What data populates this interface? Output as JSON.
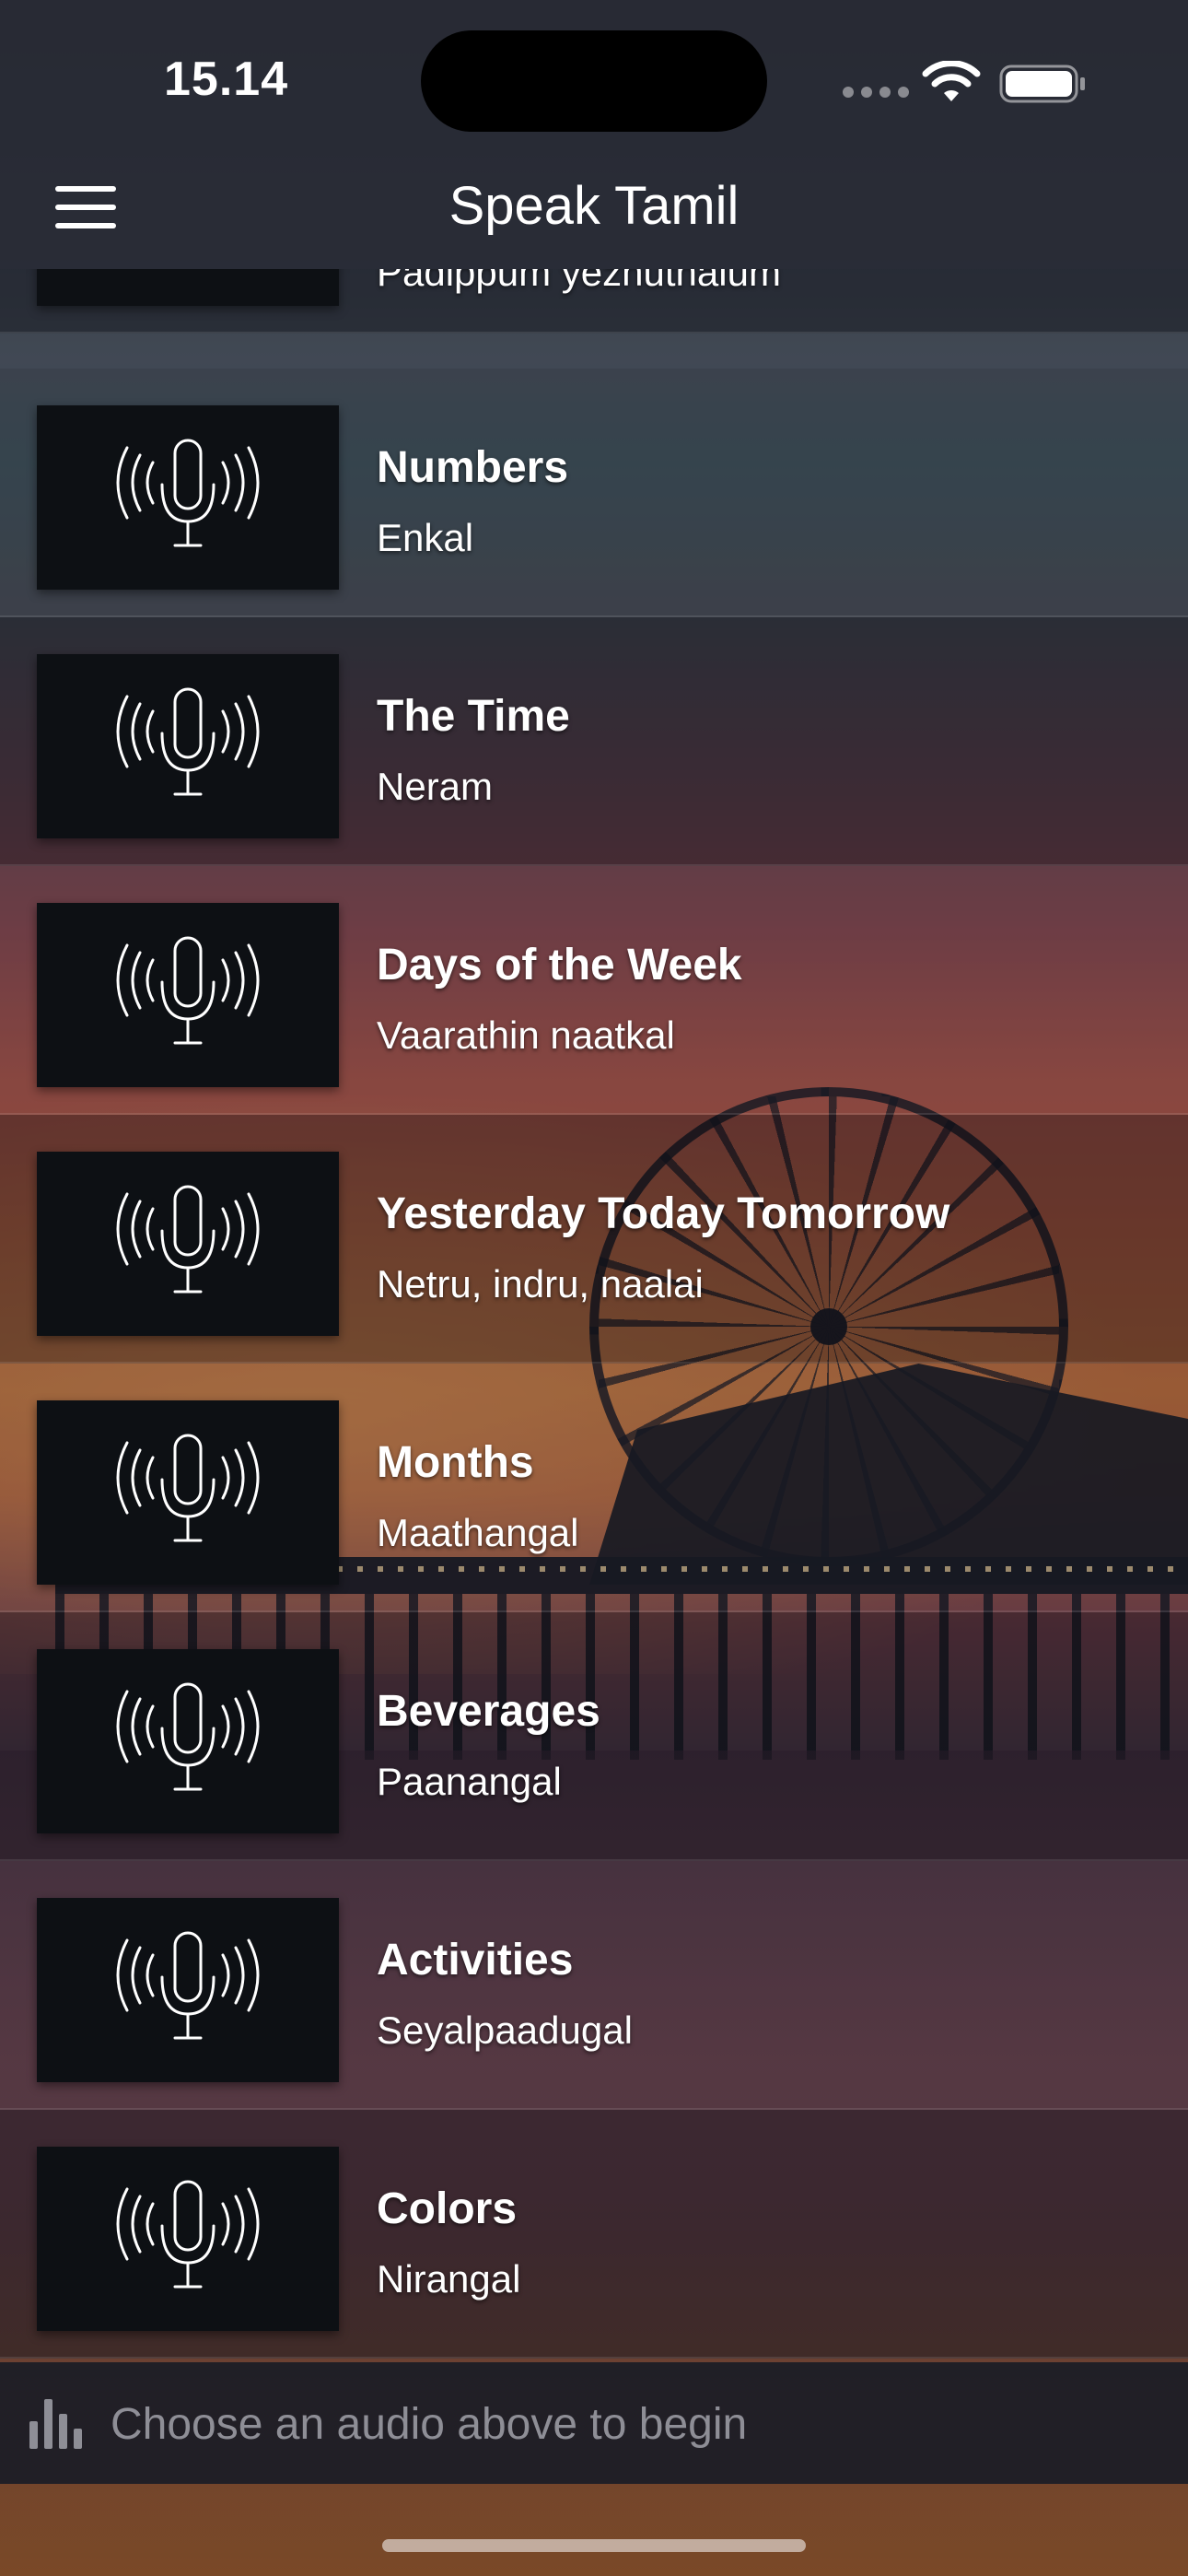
{
  "status_bar": {
    "time": "15.14",
    "icons": [
      "signal-dots-icon",
      "wifi-icon",
      "battery-icon"
    ]
  },
  "nav": {
    "title": "Speak Tamil",
    "menu_icon": "hamburger-menu-icon"
  },
  "lessons": [
    {
      "title": "",
      "subtitle": "Padippum yezhuthalum",
      "icon": "microphone-broadcast-icon"
    },
    {
      "title": "Numbers",
      "subtitle": "Enkal",
      "icon": "microphone-broadcast-icon"
    },
    {
      "title": "The Time",
      "subtitle": "Neram",
      "icon": "microphone-broadcast-icon"
    },
    {
      "title": "Days of the Week",
      "subtitle": "Vaarathin naatkal",
      "icon": "microphone-broadcast-icon"
    },
    {
      "title": "Yesterday Today Tomorrow",
      "subtitle": "Netru, indru, naalai",
      "icon": "microphone-broadcast-icon"
    },
    {
      "title": "Months",
      "subtitle": "Maathangal",
      "icon": "microphone-broadcast-icon"
    },
    {
      "title": "Beverages",
      "subtitle": "Paanangal",
      "icon": "microphone-broadcast-icon"
    },
    {
      "title": "Activities",
      "subtitle": "Seyalpaadugal",
      "icon": "microphone-broadcast-icon"
    },
    {
      "title": "Colors",
      "subtitle": "Nirangal",
      "icon": "microphone-broadcast-icon"
    }
  ],
  "player": {
    "placeholder": "Choose an audio above to begin",
    "icon": "audio-bars-icon"
  },
  "colors": {
    "thumb_background": "#0d1014",
    "player_text": "#8e8e96"
  }
}
